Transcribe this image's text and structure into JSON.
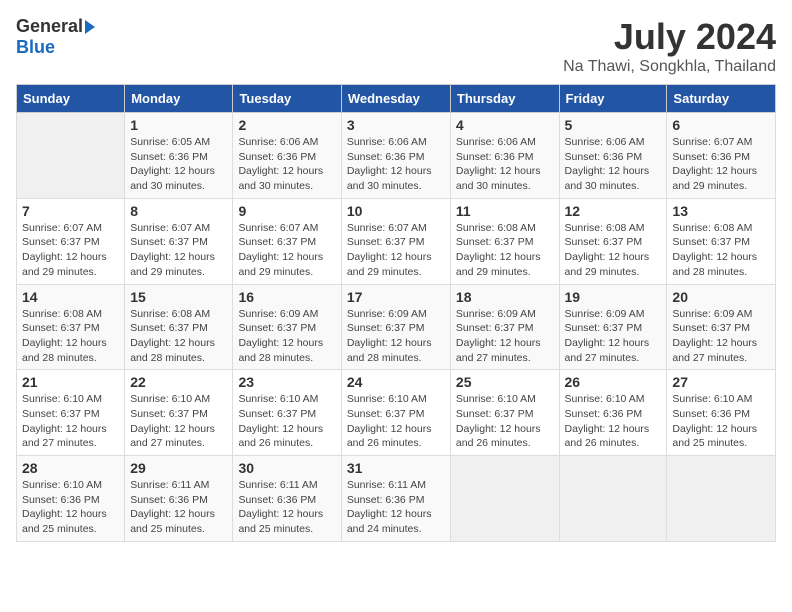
{
  "header": {
    "logo_general": "General",
    "logo_blue": "Blue",
    "title": "July 2024",
    "location": "Na Thawi, Songkhla, Thailand"
  },
  "weekdays": [
    "Sunday",
    "Monday",
    "Tuesday",
    "Wednesday",
    "Thursday",
    "Friday",
    "Saturday"
  ],
  "weeks": [
    [
      {
        "day": "",
        "detail": ""
      },
      {
        "day": "1",
        "detail": "Sunrise: 6:05 AM\nSunset: 6:36 PM\nDaylight: 12 hours\nand 30 minutes."
      },
      {
        "day": "2",
        "detail": "Sunrise: 6:06 AM\nSunset: 6:36 PM\nDaylight: 12 hours\nand 30 minutes."
      },
      {
        "day": "3",
        "detail": "Sunrise: 6:06 AM\nSunset: 6:36 PM\nDaylight: 12 hours\nand 30 minutes."
      },
      {
        "day": "4",
        "detail": "Sunrise: 6:06 AM\nSunset: 6:36 PM\nDaylight: 12 hours\nand 30 minutes."
      },
      {
        "day": "5",
        "detail": "Sunrise: 6:06 AM\nSunset: 6:36 PM\nDaylight: 12 hours\nand 30 minutes."
      },
      {
        "day": "6",
        "detail": "Sunrise: 6:07 AM\nSunset: 6:36 PM\nDaylight: 12 hours\nand 29 minutes."
      }
    ],
    [
      {
        "day": "7",
        "detail": "Sunrise: 6:07 AM\nSunset: 6:37 PM\nDaylight: 12 hours\nand 29 minutes."
      },
      {
        "day": "8",
        "detail": "Sunrise: 6:07 AM\nSunset: 6:37 PM\nDaylight: 12 hours\nand 29 minutes."
      },
      {
        "day": "9",
        "detail": "Sunrise: 6:07 AM\nSunset: 6:37 PM\nDaylight: 12 hours\nand 29 minutes."
      },
      {
        "day": "10",
        "detail": "Sunrise: 6:07 AM\nSunset: 6:37 PM\nDaylight: 12 hours\nand 29 minutes."
      },
      {
        "day": "11",
        "detail": "Sunrise: 6:08 AM\nSunset: 6:37 PM\nDaylight: 12 hours\nand 29 minutes."
      },
      {
        "day": "12",
        "detail": "Sunrise: 6:08 AM\nSunset: 6:37 PM\nDaylight: 12 hours\nand 29 minutes."
      },
      {
        "day": "13",
        "detail": "Sunrise: 6:08 AM\nSunset: 6:37 PM\nDaylight: 12 hours\nand 28 minutes."
      }
    ],
    [
      {
        "day": "14",
        "detail": "Sunrise: 6:08 AM\nSunset: 6:37 PM\nDaylight: 12 hours\nand 28 minutes."
      },
      {
        "day": "15",
        "detail": "Sunrise: 6:08 AM\nSunset: 6:37 PM\nDaylight: 12 hours\nand 28 minutes."
      },
      {
        "day": "16",
        "detail": "Sunrise: 6:09 AM\nSunset: 6:37 PM\nDaylight: 12 hours\nand 28 minutes."
      },
      {
        "day": "17",
        "detail": "Sunrise: 6:09 AM\nSunset: 6:37 PM\nDaylight: 12 hours\nand 28 minutes."
      },
      {
        "day": "18",
        "detail": "Sunrise: 6:09 AM\nSunset: 6:37 PM\nDaylight: 12 hours\nand 27 minutes."
      },
      {
        "day": "19",
        "detail": "Sunrise: 6:09 AM\nSunset: 6:37 PM\nDaylight: 12 hours\nand 27 minutes."
      },
      {
        "day": "20",
        "detail": "Sunrise: 6:09 AM\nSunset: 6:37 PM\nDaylight: 12 hours\nand 27 minutes."
      }
    ],
    [
      {
        "day": "21",
        "detail": "Sunrise: 6:10 AM\nSunset: 6:37 PM\nDaylight: 12 hours\nand 27 minutes."
      },
      {
        "day": "22",
        "detail": "Sunrise: 6:10 AM\nSunset: 6:37 PM\nDaylight: 12 hours\nand 27 minutes."
      },
      {
        "day": "23",
        "detail": "Sunrise: 6:10 AM\nSunset: 6:37 PM\nDaylight: 12 hours\nand 26 minutes."
      },
      {
        "day": "24",
        "detail": "Sunrise: 6:10 AM\nSunset: 6:37 PM\nDaylight: 12 hours\nand 26 minutes."
      },
      {
        "day": "25",
        "detail": "Sunrise: 6:10 AM\nSunset: 6:37 PM\nDaylight: 12 hours\nand 26 minutes."
      },
      {
        "day": "26",
        "detail": "Sunrise: 6:10 AM\nSunset: 6:36 PM\nDaylight: 12 hours\nand 26 minutes."
      },
      {
        "day": "27",
        "detail": "Sunrise: 6:10 AM\nSunset: 6:36 PM\nDaylight: 12 hours\nand 25 minutes."
      }
    ],
    [
      {
        "day": "28",
        "detail": "Sunrise: 6:10 AM\nSunset: 6:36 PM\nDaylight: 12 hours\nand 25 minutes."
      },
      {
        "day": "29",
        "detail": "Sunrise: 6:11 AM\nSunset: 6:36 PM\nDaylight: 12 hours\nand 25 minutes."
      },
      {
        "day": "30",
        "detail": "Sunrise: 6:11 AM\nSunset: 6:36 PM\nDaylight: 12 hours\nand 25 minutes."
      },
      {
        "day": "31",
        "detail": "Sunrise: 6:11 AM\nSunset: 6:36 PM\nDaylight: 12 hours\nand 24 minutes."
      },
      {
        "day": "",
        "detail": ""
      },
      {
        "day": "",
        "detail": ""
      },
      {
        "day": "",
        "detail": ""
      }
    ]
  ]
}
